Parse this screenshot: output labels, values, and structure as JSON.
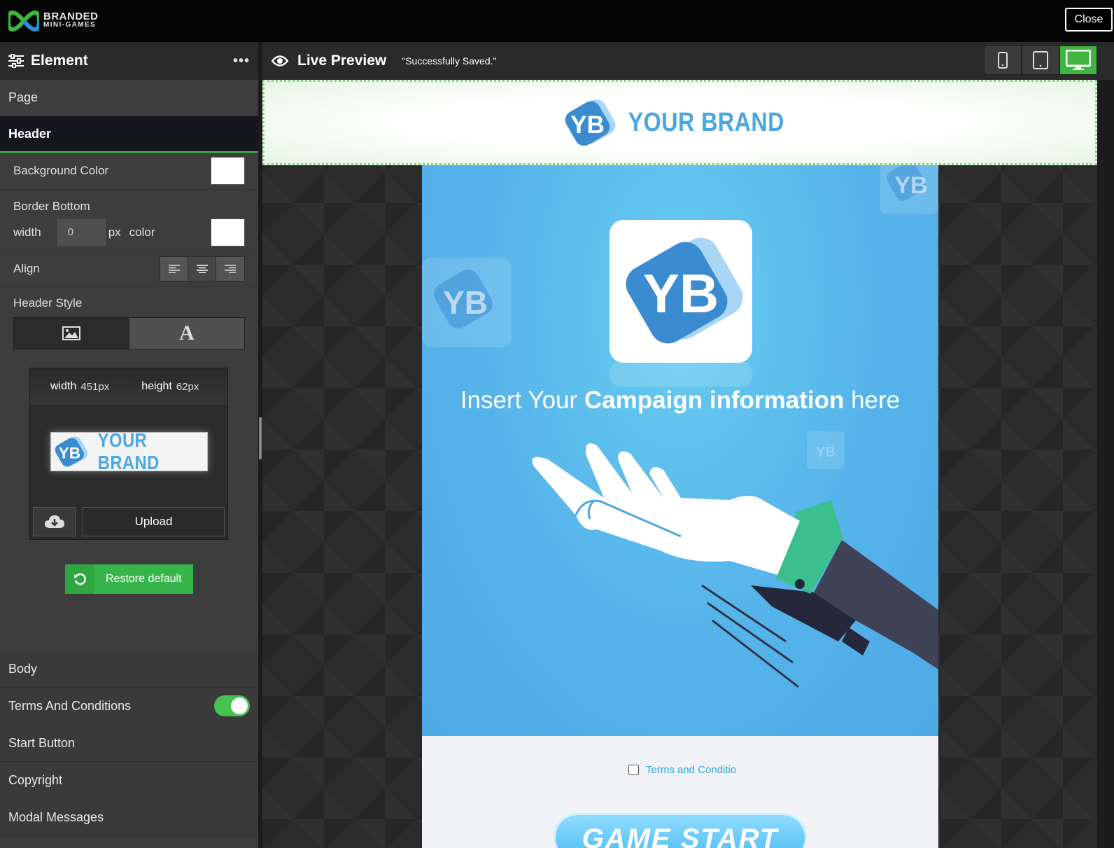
{
  "app": {
    "logo_line1": "BRANDED",
    "logo_line2": "MINI-GAMES",
    "close_label": "Close"
  },
  "panel": {
    "title": "Element",
    "more": "•••",
    "sections_top": [
      "Page",
      "Header"
    ],
    "header_props": {
      "background_color_label": "Background Color",
      "background_color": "#ffffff",
      "border_bottom_label": "Border Bottom",
      "width_label": "width",
      "width_value": "0",
      "px_unit": "px",
      "color_label": "color",
      "border_color": "#ffffff",
      "align_label": "Align",
      "align_selected": "center",
      "header_style_label": "Header Style",
      "header_style_selected": "image"
    },
    "image_card": {
      "width_label": "width",
      "width_value": "451px",
      "height_label": "height",
      "height_value": "62px",
      "brand_initials": "YB",
      "brand_name": "YOUR BRAND",
      "upload_label": "Upload"
    },
    "restore_label": "Restore default",
    "sections_bottom": {
      "body": "Body",
      "terms": "Terms And Conditions",
      "terms_enabled": true,
      "start_button": "Start Button",
      "copyright": "Copyright",
      "modal_messages": "Modal Messages"
    }
  },
  "preview": {
    "title": "Live Preview",
    "status": "\"Successfully Saved.\"",
    "devices": [
      "mobile",
      "tablet",
      "desktop"
    ],
    "active_device": "desktop",
    "header_brand_initials": "YB",
    "header_brand_name": "YOUR BRAND",
    "campaign_part1": "Insert Your ",
    "campaign_bold": "Campaign information",
    "campaign_part2": " here",
    "terms_link": "Terms and Conditio",
    "start_label": "GAME START"
  },
  "colors": {
    "accent_green": "#3fb63d",
    "game_blue": "#56b3ea",
    "brand_blue": "#4aa7e2"
  }
}
